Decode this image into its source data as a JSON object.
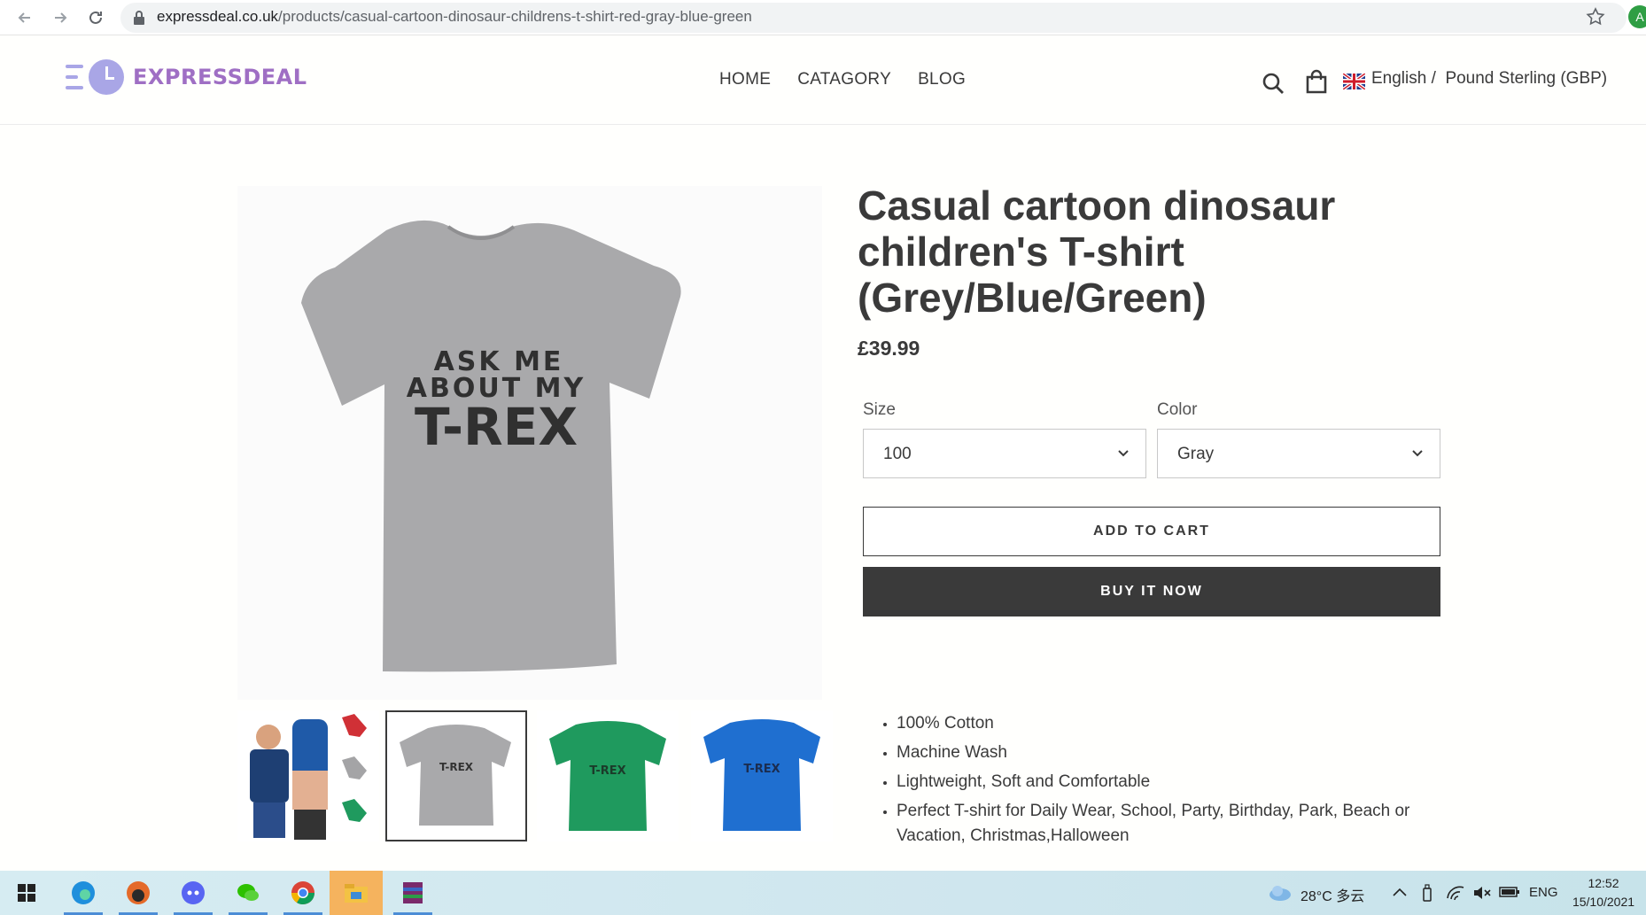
{
  "browser": {
    "url_host": "expressdeal.co.uk",
    "url_path": "/products/casual-cartoon-dinosaur-childrens-t-shirt-red-gray-blue-green",
    "profile_initial": "A"
  },
  "header": {
    "logo_text": "EXPRESSDEAL",
    "nav": [
      "HOME",
      "CATAGORY",
      "BLOG"
    ],
    "language": "English /",
    "currency": "Pound Sterling (GBP)"
  },
  "product": {
    "title": "Casual cartoon dinosaur children's T-shirt (Grey/Blue/Green)",
    "price": "£39.99",
    "shirt_print": [
      "ASK ME",
      "ABOUT MY",
      "T-REX"
    ],
    "size_label": "Size",
    "size_value": "100",
    "color_label": "Color",
    "color_value": "Gray",
    "add_to_cart": "ADD TO CART",
    "buy_now": "BUY IT NOW",
    "features": [
      "100% Cotton",
      "Machine Wash",
      "Lightweight, Soft and Comfortable",
      "Perfect T-shirt for Daily Wear, School, Party, Birthday, Park, Beach or Vacation, Christmas,Halloween"
    ],
    "colors": {
      "gray": "#a9a9ab",
      "green": "#1f9a5e",
      "blue": "#1f6fd0",
      "text": "#3a3a3a",
      "accent": "#9f6fc4"
    }
  },
  "taskbar": {
    "weather": "28°C 多云",
    "lang": "ENG",
    "time": "12:52",
    "date": "15/10/2021"
  }
}
